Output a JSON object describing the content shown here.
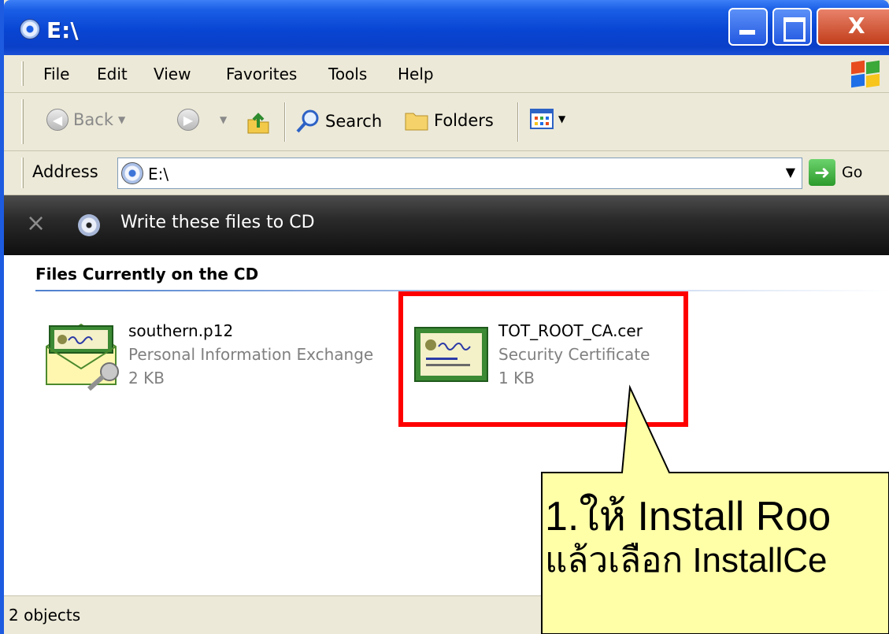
{
  "window": {
    "title": "E:\\"
  },
  "menu": [
    "File",
    "Edit",
    "View",
    "Favorites",
    "Tools",
    "Help"
  ],
  "toolbar": {
    "back": "Back",
    "search": "Search",
    "folders": "Folders"
  },
  "address": {
    "label": "Address",
    "value": "E:\\",
    "go": "Go"
  },
  "cd_tasks": {
    "message": "Write these files to CD"
  },
  "content": {
    "group_header": "Files Currently on the CD",
    "files": [
      {
        "name": "southern.p12",
        "type": "Personal Information Exchange",
        "size": "2 KB"
      },
      {
        "name": "TOT_ROOT_CA.cer",
        "type": "Security Certificate",
        "size": "1 KB"
      }
    ]
  },
  "status": {
    "objects": "2 objects"
  },
  "callout": {
    "line1": "1.ให้ Install Roo",
    "line2": "แล้วเลือก InstallCe"
  },
  "colors": {
    "highlight": "#ff0000",
    "callout_fill": "#ffffa8",
    "titlebar": "#0845d2"
  }
}
